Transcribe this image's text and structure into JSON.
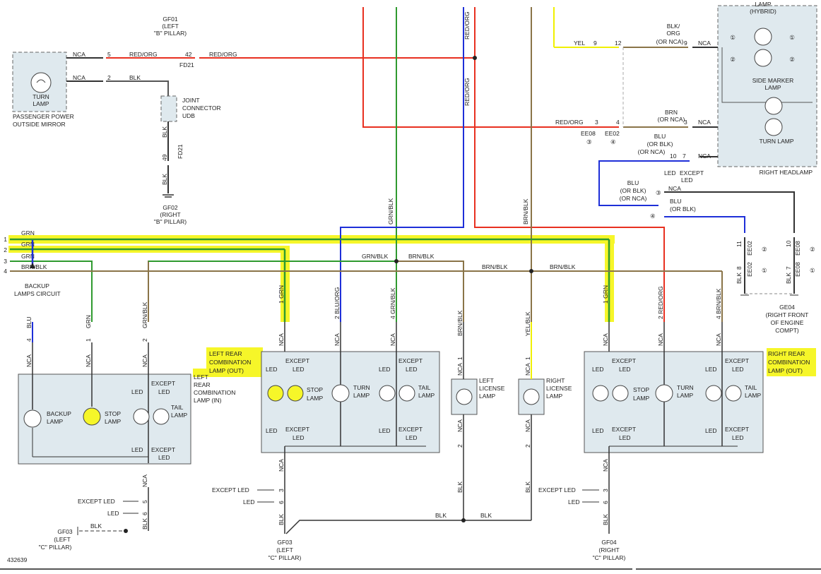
{
  "diagram_id": "432639",
  "colors": {
    "red": "#e83020",
    "green": "#2f9a2f",
    "blue": "#1e2fd8",
    "yellow": "#f0f000",
    "brown": "#8a7448",
    "black": "#333333",
    "highlight": "#f6f629",
    "box_fill": "#dfe9ee"
  },
  "top": {
    "gf01": [
      "GF01",
      "(LEFT",
      "\"B\" PILLAR)"
    ],
    "mirror_label": [
      "PASSENGER POWER",
      "OUTSIDE MIRROR"
    ],
    "mirror_lamp": [
      "TURN",
      "LAMP"
    ],
    "nca": "NCA",
    "pin5": "5",
    "pin2": "2",
    "pin42": "42",
    "pin49": "49",
    "red_org": "RED/ORG",
    "blk": "BLK",
    "fd21": "FD21",
    "joint": [
      "JOINT",
      "CONNECTOR",
      "UDB"
    ],
    "gf02": [
      "GF02",
      "(RIGHT",
      "\"B\" PILLAR)"
    ]
  },
  "right_head": {
    "parking_lamp": [
      "LAMP",
      "(HYBRID)"
    ],
    "side_marker": [
      "SIDE MARKER",
      "LAMP"
    ],
    "turn_lamp": "TURN LAMP",
    "title": "RIGHT HEADLAMP",
    "yel": "YEL",
    "pin9": "9",
    "pin12": "12",
    "pin4": "4",
    "pin3": "3",
    "blk_org": [
      "BLK/",
      "ORG",
      "(OR NCA)"
    ],
    "red_org": "RED/ORG",
    "brn": [
      "BRN",
      "(OR NCA)"
    ],
    "ee08": "EE08",
    "ee02": "EE02",
    "c3": "③",
    "c4": "④",
    "blu": [
      "BLU",
      "(OR BLK)",
      "(OR NCA)"
    ],
    "pin10": "10",
    "pin7": "7",
    "led": "LED",
    "except_led": [
      "EXCEPT",
      "LED"
    ],
    "blu2": [
      "BLU",
      "(OR BLK)",
      "(OR NCA)"
    ],
    "blu3": [
      "BLU",
      "(OR BLK)"
    ],
    "nca": "NCA",
    "e11": "11",
    "e8": "8",
    "e10": "10",
    "e7": "7",
    "c1": "①",
    "c2": "②",
    "ge04": [
      "GE04",
      "(RIGHT FRONT",
      "OF ENGINE",
      "COMPT)"
    ]
  },
  "vertical_labels": {
    "red_org": "RED/ORG",
    "grn_blk": "GRN/BLK",
    "brn_blk": "BRN/BLK"
  },
  "rail": {
    "nums": [
      "1",
      "2",
      "3",
      "4"
    ],
    "grn": "GRN",
    "brn_blk": "BRN/BLK",
    "grn_blk": "GRN/BLK"
  },
  "left_in": {
    "backup_circuit": [
      "BACKUP",
      "LAMPS CIRCUIT"
    ],
    "title": [
      "LEFT",
      "REAR",
      "COMBINATION",
      "LAMP (IN)"
    ],
    "backup_lamp": [
      "BACKUP",
      "LAMP"
    ],
    "stop_lamp": [
      "STOP",
      "LAMP"
    ],
    "tail_lamp": [
      "TAIL",
      "LAMP"
    ],
    "led": "LED",
    "except_led": [
      "EXCEPT",
      "LED"
    ],
    "blu": "BLU",
    "grn": "GRN",
    "grn_blk": "GRN/BLK",
    "blk": "BLK",
    "p4": "4",
    "p1": "1",
    "p2": "2",
    "p5": "5",
    "p6": "6",
    "except_led_line": "EXCEPT LED",
    "led_line": "LED",
    "gf03": [
      "GF03",
      "(LEFT",
      "\"C\" PILLAR)"
    ]
  },
  "left_out": {
    "title": [
      "LEFT REAR",
      "COMBINATION",
      "LAMP (OUT)"
    ],
    "stop_lamp": [
      "STOP",
      "LAMP"
    ],
    "turn_lamp": [
      "TURN",
      "LAMP"
    ],
    "tail_lamp": [
      "TAIL",
      "LAMP"
    ],
    "led": "LED",
    "except_led": [
      "EXCEPT",
      "LED"
    ],
    "w1": "1 GRN",
    "w2": "2 BLU/ORG",
    "w4": "4 GRN/BLK",
    "p3": "3",
    "p6": "6",
    "except_led_line": "EXCEPT LED",
    "led_line": "LED",
    "gf03": [
      "GF03",
      "(LEFT",
      "\"C\" PILLAR)"
    ]
  },
  "license": {
    "left": [
      "LEFT",
      "LICENSE",
      "LAMP"
    ],
    "right": [
      "RIGHT",
      "LICENSE",
      "LAMP"
    ],
    "brn_blk": "BRN/BLK",
    "yel_blk": "YEL/BLK",
    "p1": "1",
    "p2": "2",
    "blk": "BLK"
  },
  "right_out": {
    "title": [
      "RIGHT REAR",
      "COMBINATION",
      "LAMP (OUT)"
    ],
    "stop_lamp": [
      "STOP",
      "LAMP"
    ],
    "turn_lamp": [
      "TURN",
      "LAMP"
    ],
    "tail_lamp": [
      "TAIL",
      "LAMP"
    ],
    "led": "LED",
    "except_led": [
      "EXCEPT",
      "LED"
    ],
    "w1": "1 GRN",
    "w2": "2 RED/ORG",
    "w4": "4 BRN/BLK",
    "p3": "3",
    "p6": "6",
    "except_led_line": "EXCEPT LED",
    "led_line": "LED",
    "gf04": [
      "GF04",
      "(RIGHT",
      "\"C\" PILLAR)"
    ]
  }
}
